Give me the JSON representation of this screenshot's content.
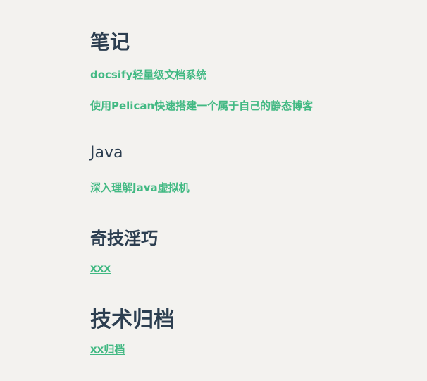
{
  "sections": [
    {
      "heading": "笔记",
      "links": [
        "docsify轻量级文档系统",
        "使用Pelican快速搭建一个属于自己的静态博客"
      ]
    },
    {
      "heading": "Java",
      "links": [
        "深入理解Java虚拟机"
      ]
    },
    {
      "heading": "奇技淫巧",
      "links": [
        "xxx"
      ]
    },
    {
      "heading": "技术归档",
      "links": [
        "xx归档"
      ]
    }
  ],
  "colors": {
    "background": "#f3f2ef",
    "heading": "#2c3e50",
    "link": "#42b983"
  }
}
